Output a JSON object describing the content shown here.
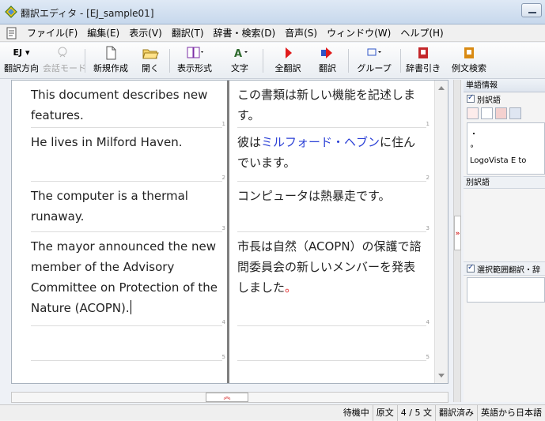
{
  "window": {
    "title": "翻訳エディタ - [EJ_sample01]"
  },
  "menu": [
    "ファイル(F)",
    "編集(E)",
    "表示(V)",
    "翻訳(T)",
    "辞書・検索(D)",
    "音声(S)",
    "ウィンドウ(W)",
    "ヘルプ(H)"
  ],
  "toolbar": {
    "direction": "翻訳方向",
    "direction_code": "EJ",
    "conversation_mode": "会話モード",
    "new": "新規作成",
    "open": "開く",
    "display_format": "表示形式",
    "font": "文字",
    "translate_all": "全翻訳",
    "translate": "翻訳",
    "group": "グループ",
    "dictionary_lookup": "辞書引き",
    "example_search": "例文検索"
  },
  "segments": [
    {
      "source": "This document describes new features.",
      "target": "この書類は新しい機能を記述します。",
      "num": "1"
    },
    {
      "source": "He lives in Milford Haven.",
      "target_pre": "彼は",
      "target_hl": "ミルフォード・ヘブン",
      "target_post": "に住んでいます。",
      "num": "2"
    },
    {
      "source": "The computer is a thermal runaway.",
      "target": "コンピュータは熱暴走です。",
      "num": "3"
    },
    {
      "source": "The mayor announced the new member of the Advisory Committee on Protection of the Nature (ACOPN).",
      "target_pre": "市長は自然（ACOPN）の保護で諮問委員会の新しいメンバーを発表しました",
      "target_mark": "。",
      "num": "4"
    },
    {
      "source": "",
      "target": "",
      "num": "5"
    }
  ],
  "right_panel": {
    "header": "単語情報",
    "alt_translation_check": "別訳語",
    "dict_lines": [
      "・",
      "°",
      "LogoVista E to"
    ],
    "alt_word_label": "別訳語",
    "selection_check": "選択範囲翻訳・辞"
  },
  "status": {
    "state": "待機中",
    "view": "原文",
    "position": "4 / 5 文",
    "translated": "翻訳済み",
    "direction": "英語から日本語"
  },
  "colors": {
    "highlight": "#2a3fd6",
    "accent_red": "#d21d1d"
  }
}
